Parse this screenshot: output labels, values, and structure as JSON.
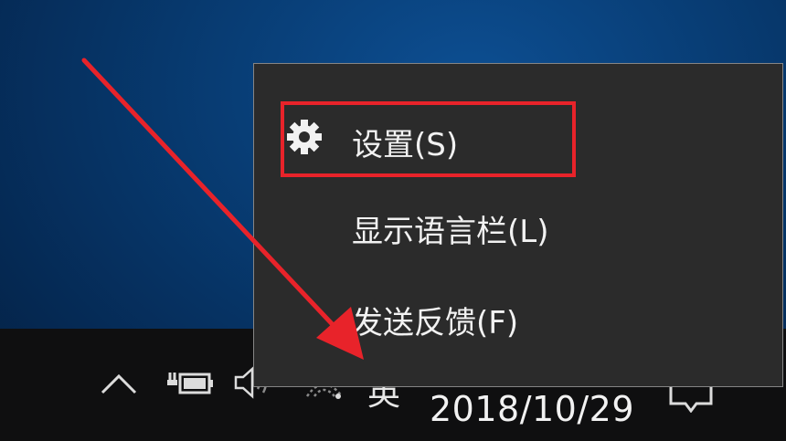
{
  "context_menu": {
    "items": [
      {
        "label": "设置(S)",
        "icon": "gear-icon"
      },
      {
        "label": "显示语言栏(L)"
      },
      {
        "label": "发送反馈(F)"
      }
    ]
  },
  "taskbar": {
    "ime_indicator": "英",
    "date": "2018/10/29",
    "icons": [
      "chevron-up-icon",
      "battery-icon",
      "volume-icon",
      "network-icon",
      "notification-icon"
    ]
  },
  "annotation": {
    "arrow_color": "#e8232a",
    "highlight_color": "#e8232a"
  },
  "colors": {
    "menu_bg": "#2b2b2b",
    "taskbar_bg": "#0f0f10",
    "desktop_bg": "#07396e"
  }
}
